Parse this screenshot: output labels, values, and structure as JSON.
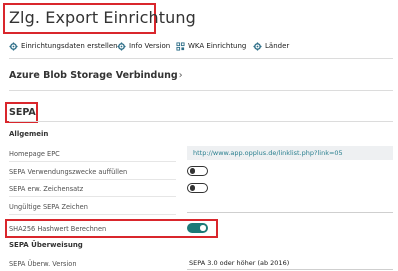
{
  "page": {
    "title": "Zlg. Export Einrichtung"
  },
  "actions": [
    {
      "label": "Einrichtungsdaten erstellen",
      "icon": "gear-icon"
    },
    {
      "label": "Info Version",
      "icon": "gear-icon"
    },
    {
      "label": "WKA Einrichtung",
      "icon": "grid-icon"
    },
    {
      "label": "Länder",
      "icon": "gear-icon"
    }
  ],
  "sections": {
    "azure": {
      "title": "Azure Blob Storage Verbindung",
      "chevron": "›"
    },
    "sepa": {
      "title": "SEPA"
    }
  },
  "groups": {
    "allgemein": "Allgemein",
    "ueberweisung": "SEPA Überweisung"
  },
  "fields": {
    "homepage_epc": {
      "label": "Homepage EPC",
      "value": "http://www.app.opplus.de/linklist.php?link=05"
    },
    "verwendungszwecke": {
      "label": "SEPA Verwendungszwecke auffüllen",
      "checked": false
    },
    "erw_zeichensatz": {
      "label": "SEPA erw. Zeichensatz",
      "checked": false
    },
    "ungueltige_zeichen": {
      "label": "Ungültige SEPA Zeichen",
      "value": ""
    },
    "sha256": {
      "label": "SHA256 Hashwert Berechnen",
      "checked": true
    },
    "ueberw_version": {
      "label": "SEPA Überw. Version",
      "value": "SEPA 3.0 oder höher (ab 2016)"
    }
  },
  "colors": {
    "highlight": "#d9262c",
    "toggle_on": "#1c7a78",
    "link": "#2a7f8f",
    "icon": "#2e6e88"
  }
}
